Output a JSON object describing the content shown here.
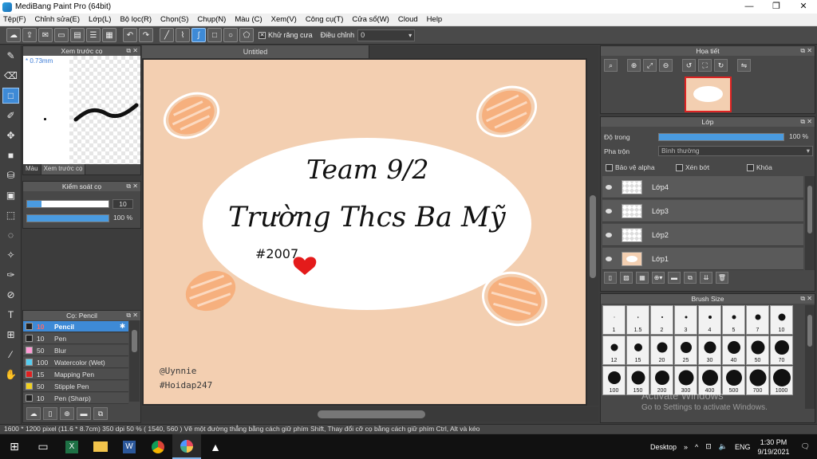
{
  "window": {
    "title": "MediBang Paint Pro (64bit)",
    "minimize": "—",
    "maximize": "❐",
    "close": "✕"
  },
  "menu": [
    "Tệp(F)",
    "Chỉnh sửa(E)",
    "Lớp(L)",
    "Bộ lọc(R)",
    "Chọn(S)",
    "Chụp(N)",
    "Màu (C)",
    "Xem(V)",
    "Công cụ(T)",
    "Cửa sổ(W)",
    "Cloud",
    "Help"
  ],
  "toolbar": {
    "antialias_label": "Khử răng cưa",
    "antialias_checked": true,
    "adjust_label": "Điều chỉnh",
    "adjust_value": "0"
  },
  "brush_preview": {
    "title": "Xem trước cọ",
    "size": "* 0.73mm",
    "tabs": [
      "Màu",
      "Xem trước cọ"
    ]
  },
  "brush_control": {
    "title": "Kiểm soát cọ",
    "size_value": "10",
    "size_fraction": 0.18,
    "opacity_value": "100 %",
    "opacity_fraction": 1.0
  },
  "brush_list": {
    "title": "Cọ: Pencil",
    "items": [
      {
        "size": "10",
        "name": "Pencil",
        "color": "#222222",
        "selected": true
      },
      {
        "size": "10",
        "name": "Pen",
        "color": "#222222",
        "selected": false
      },
      {
        "size": "50",
        "name": "Blur",
        "color": "#ff9ad5",
        "selected": false
      },
      {
        "size": "100",
        "name": "Watercolor (Wet)",
        "color": "#55ccf0",
        "selected": false
      },
      {
        "size": "15",
        "name": "Mapping Pen",
        "color": "#e02020",
        "selected": false
      },
      {
        "size": "50",
        "name": "Stipple Pen",
        "color": "#f0d020",
        "selected": false
      },
      {
        "size": "10",
        "name": "Pen (Sharp)",
        "color": "#222222",
        "selected": false
      }
    ]
  },
  "document": {
    "tab_title": "Untitled",
    "artwork": {
      "title_line": "Team 9/2",
      "school_line": "Trường Thcs Ba Mỹ",
      "hashtag": "#2007",
      "signature_1": "@Uynnie",
      "signature_2": "#Hoidap247",
      "colors": {
        "background": "#f3cfb1",
        "ellipse": "#ffffff",
        "egg": "#f6b07e",
        "heart": "#e41b1b"
      }
    }
  },
  "navigator": {
    "title": "Họa tiết"
  },
  "layers": {
    "title": "Lớp",
    "opacity_label": "Độ trong",
    "opacity_value": "100 %",
    "blend_label": "Pha trộn",
    "blend_value": "Bình thường",
    "lock_alpha": "Bảo vệ alpha",
    "clipping": "Xén bớt",
    "lock": "Khóa",
    "items": [
      "Lớp4",
      "Lớp3",
      "Lớp2",
      "Lớp1"
    ]
  },
  "brush_size": {
    "title": "Brush Size",
    "sizes": [
      "1",
      "1.5",
      "2",
      "3",
      "4",
      "5",
      "7",
      "10",
      "12",
      "15",
      "20",
      "25",
      "30",
      "40",
      "50",
      "70",
      "100",
      "150",
      "200",
      "300",
      "400",
      "500",
      "700",
      "1000"
    ]
  },
  "watermark": {
    "line1": "Activate Windows",
    "line2": "Go to Settings to activate Windows."
  },
  "status": "1600 * 1200 pixel   (11.6 * 8.7cm)   350 dpi   50 %   ( 1540, 560 )   Vẽ một đường thẳng bằng cách giữ phím Shift, Thay đổi cỡ cọ bằng cách giữ phím Ctrl, Alt và kéo",
  "taskbar": {
    "desktop_label": "Desktop",
    "language": "ENG",
    "time": "1:30 PM",
    "date": "9/19/2021"
  }
}
